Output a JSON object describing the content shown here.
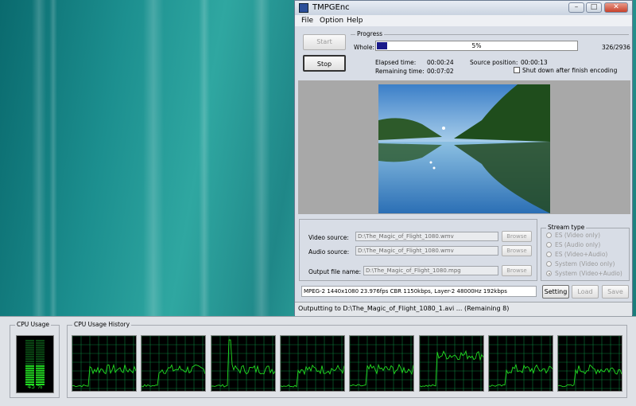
{
  "window": {
    "title": "TMPGEnc",
    "controls": {
      "minimize": "–",
      "maximize": "□",
      "close": "✕"
    },
    "menu": [
      "File",
      "Option",
      "Help"
    ],
    "start_label": "Start",
    "stop_label": "Stop",
    "progress": {
      "group_label": "Progress",
      "whole_label": "Whole:",
      "percent_text": "5%",
      "fraction": 0.05,
      "count_text": "326/2936",
      "elapsed_label": "Elapsed time:",
      "elapsed_value": "00:00:24",
      "remaining_label": "Remaining time:",
      "remaining_value": "00:07:02",
      "source_position_label": "Source position:",
      "source_position_value": "00:00:13",
      "shutdown_label": "Shut down after finish encoding"
    },
    "files": {
      "video_label": "Video source:",
      "video_value": "D:\\The_Magic_of_Flight_1080.wmv",
      "audio_label": "Audio source:",
      "audio_value": "D:\\The_Magic_of_Flight_1080.wmv",
      "output_label": "Output file name:",
      "output_value": "D:\\The_Magic_of_Flight_1080.mpg",
      "browse_label": "Browse"
    },
    "stream_type": {
      "label": "Stream type",
      "options": [
        "ES (Video only)",
        "ES (Audio only)",
        "ES (Video+Audio)",
        "System (Video only)",
        "System (Video+Audio)"
      ],
      "selected": "System (Video+Audio)"
    },
    "format_info": "MPEG-2 1440x1080 23.976fps CBR 1150kbps,  Layer-2 48000Hz 192kbps",
    "setting_label": "Setting",
    "load_label": "Load",
    "save_label": "Save",
    "status": "Outputting to D:\\The_Magic_of_Flight_1080_1.avi ... (Remaining 8)"
  },
  "task_manager": {
    "cpu_usage_label": "CPU Usage",
    "cpu_usage_value": "45 %",
    "cpu_usage_fraction": 0.45,
    "history_label": "CPU Usage History",
    "core_count": 8,
    "accent_color": "#22dd22",
    "grid_color": "#0b7a3a"
  }
}
